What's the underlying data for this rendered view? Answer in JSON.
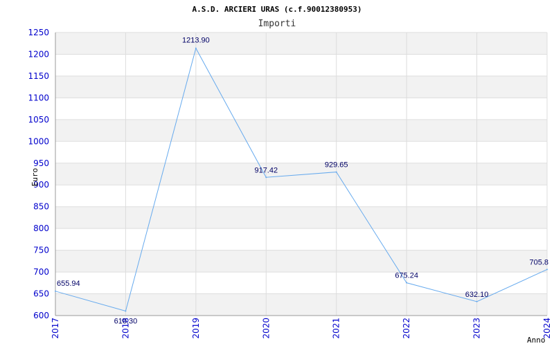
{
  "chart_data": {
    "type": "line",
    "title": "A.S.D. ARCIERI URAS (c.f.90012380953)",
    "subtitle": "Importi",
    "xlabel": "Anno",
    "ylabel": "Euro",
    "ylim": [
      600,
      1250
    ],
    "yticks": [
      "600",
      "650",
      "700",
      "750",
      "800",
      "850",
      "900",
      "950",
      "1000",
      "1050",
      "1100",
      "1150",
      "1200",
      "1250"
    ],
    "x": [
      "2017",
      "2018",
      "2019",
      "2020",
      "2021",
      "2022",
      "2023",
      "2024"
    ],
    "values": [
      655.94,
      610.3,
      1213.9,
      917.42,
      929.65,
      675.24,
      632.1,
      705.8
    ],
    "data_labels": [
      "655.94",
      "610.30",
      "1213.90",
      "917.42",
      "929.65",
      "675.24",
      "632.10",
      "705.8"
    ],
    "grid": true,
    "band_colors": [
      "#f2f2f2",
      "#ffffff"
    ],
    "line_color": "#66aaee",
    "grid_color": "#dddddd"
  }
}
